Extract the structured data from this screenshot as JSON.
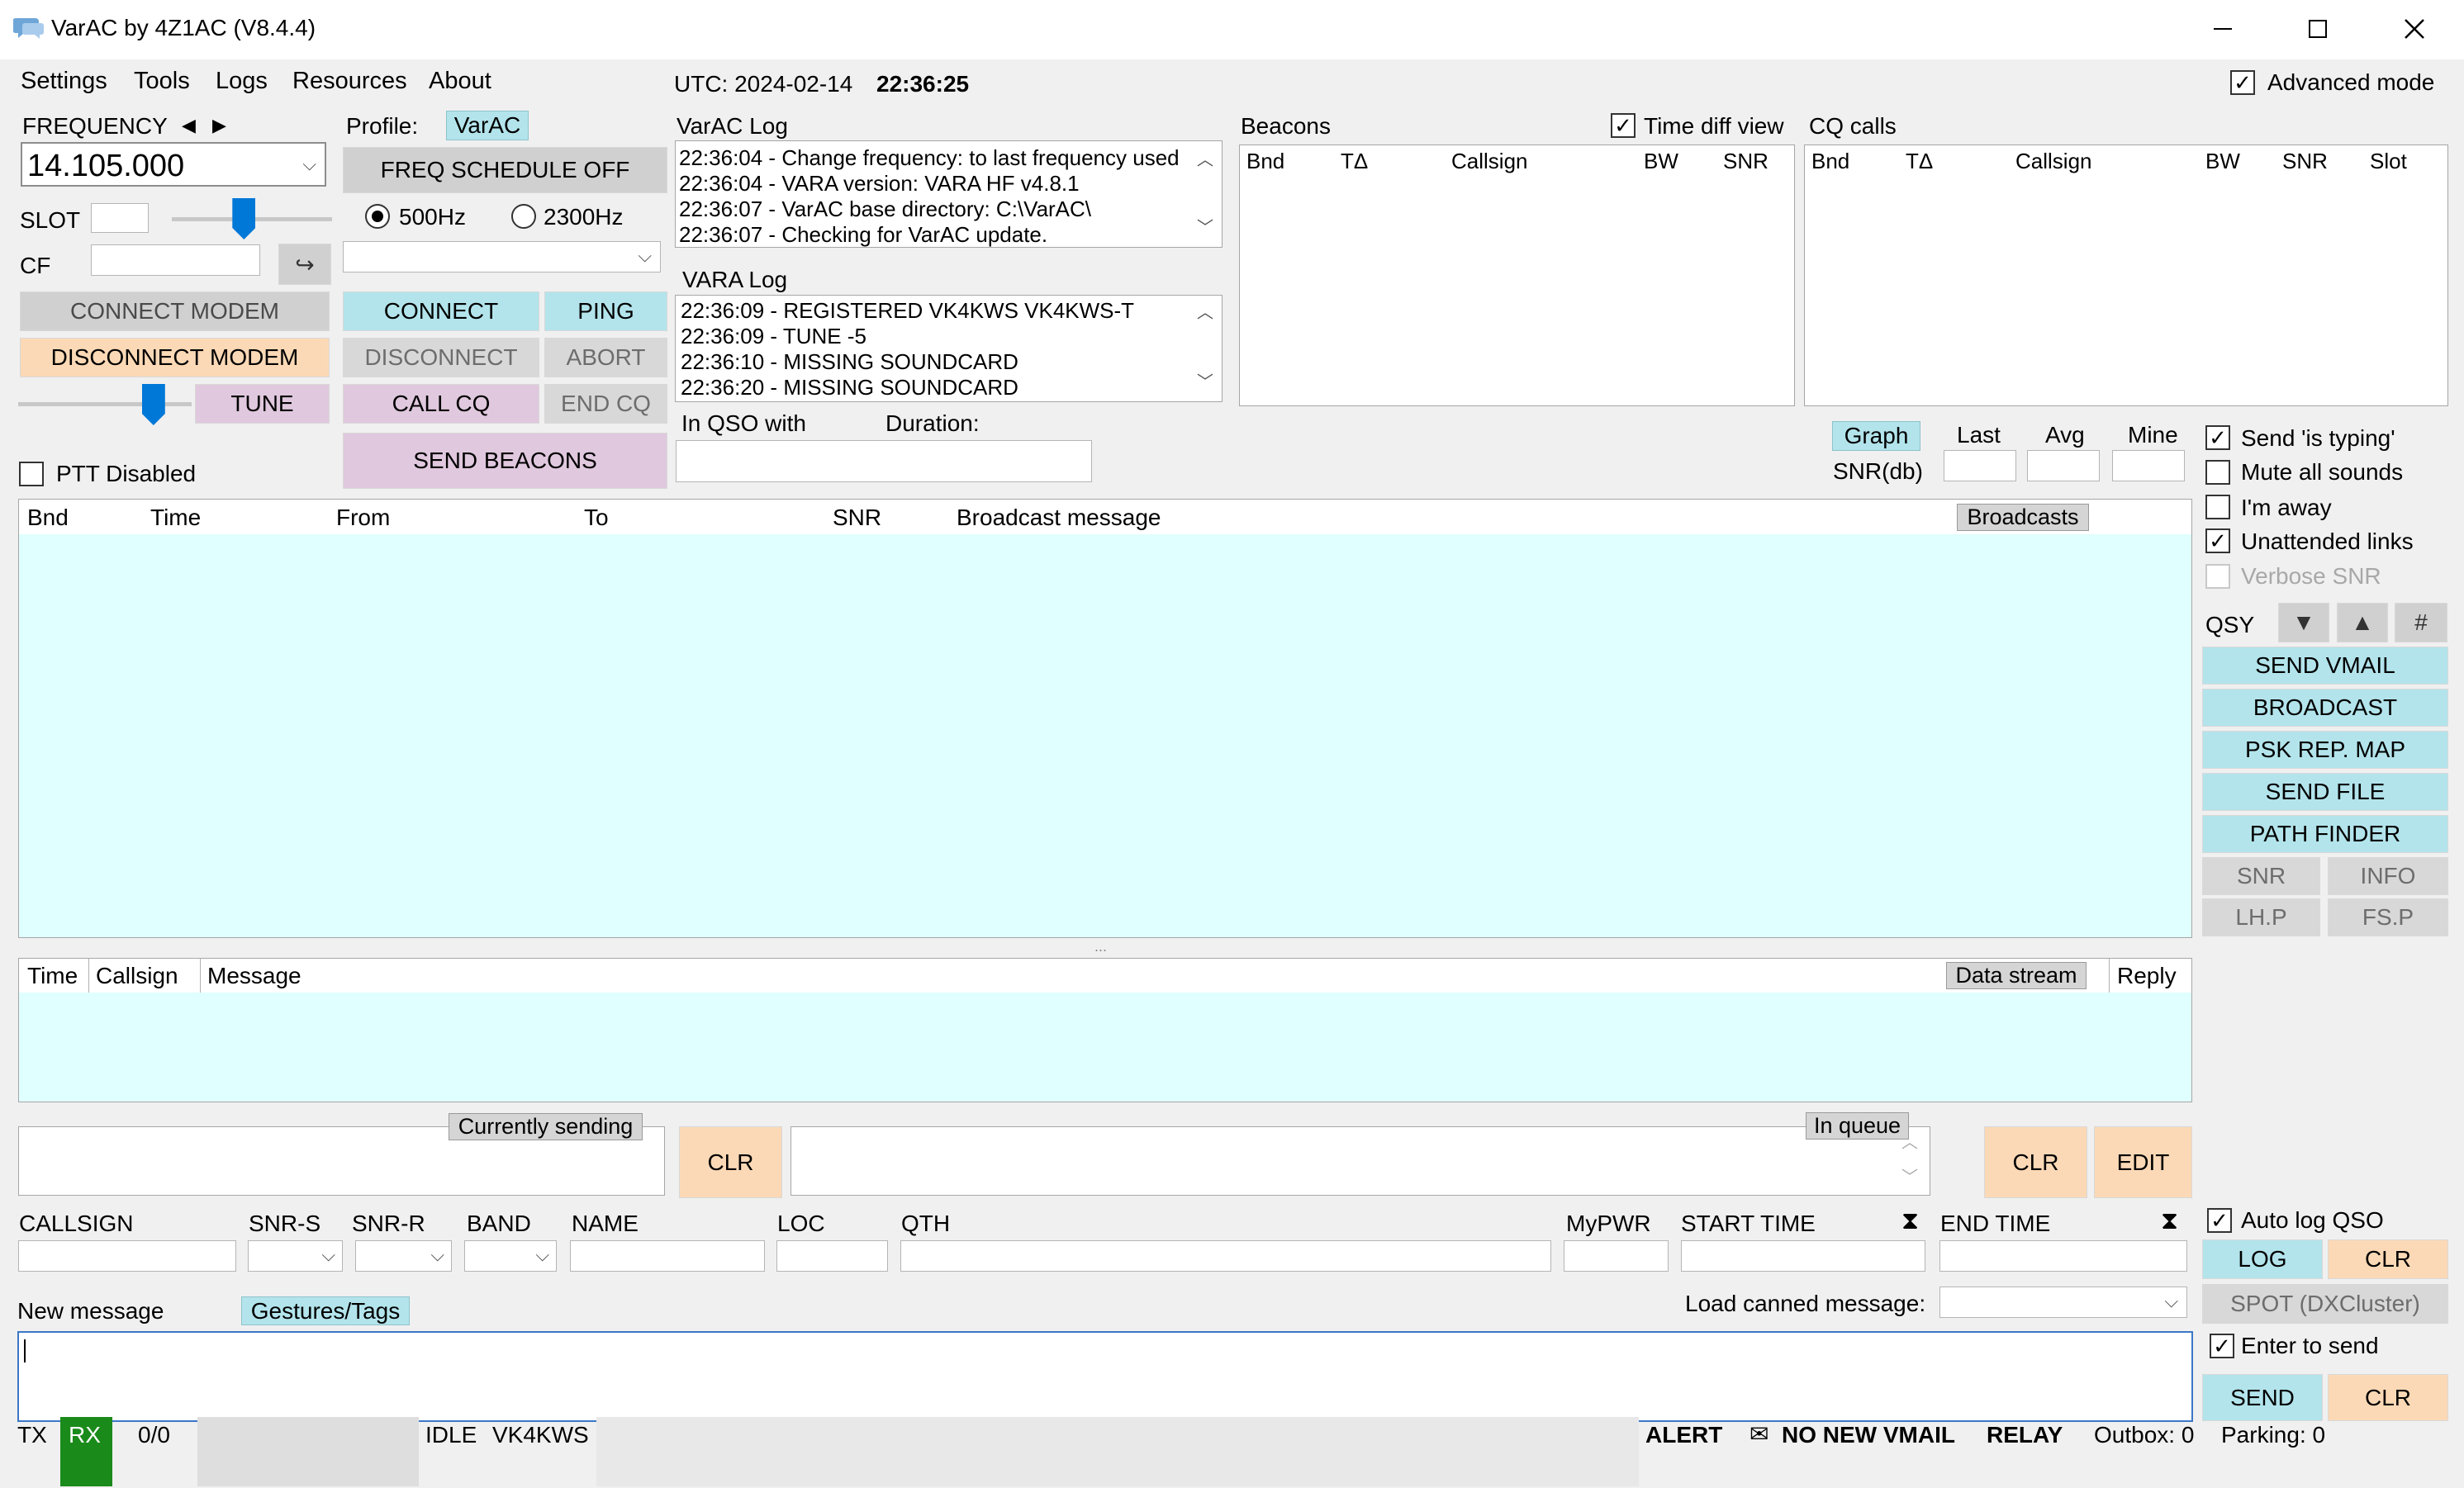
{
  "window": {
    "title": "VarAC by 4Z1AC (V8.4.4)"
  },
  "menu": [
    "Settings",
    "Tools",
    "Logs",
    "Resources",
    "About"
  ],
  "utc": {
    "label": "UTC: 2024-02-14",
    "time": "22:36:25"
  },
  "advanced_mode": {
    "label": "Advanced mode",
    "checked": true
  },
  "frequency": {
    "label": "FREQUENCY",
    "left_arrow": "◀",
    "right_arrow": "▶",
    "value": "14.105.000"
  },
  "slot": {
    "label": "SLOT",
    "value": "",
    "slider_fraction": 0.45
  },
  "cf": {
    "label": "CF",
    "value": "",
    "button_icon": "↪"
  },
  "modem": {
    "connect": "CONNECT MODEM",
    "disconnect": "DISCONNECT MODEM",
    "tune": "TUNE",
    "tune_slider_fraction": 0.78
  },
  "ptt": {
    "label": "PTT Disabled",
    "checked": false
  },
  "profile": {
    "label": "Profile:",
    "value": "VarAC",
    "freq_schedule": "FREQ SCHEDULE OFF",
    "bw_500": "500Hz",
    "bw_2300": "2300Hz",
    "bw_selected": "500Hz",
    "dropdown_value": ""
  },
  "actions": {
    "connect": "CONNECT",
    "ping": "PING",
    "disconnect": "DISCONNECT",
    "abort": "ABORT",
    "call_cq": "CALL CQ",
    "end_cq": "END CQ",
    "send_beacons": "SEND BEACONS"
  },
  "varac_log": {
    "title": "VarAC Log",
    "lines": [
      "22:36:04 - Change frequency: to last frequency used",
      "22:36:04 - VARA version: VARA HF v4.8.1",
      "22:36:07 - VarAC base directory: C:\\VarAC\\",
      "22:36:07 - Checking for VarAC update."
    ]
  },
  "vara_log": {
    "title": "VARA Log",
    "lines": [
      "22:36:09 - REGISTERED VK4KWS VK4KWS-T",
      "22:36:09 - TUNE -5",
      "22:36:10 - MISSING SOUNDCARD",
      "22:36:20 - MISSING SOUNDCARD"
    ]
  },
  "qso": {
    "in_qso_with": "In QSO with",
    "duration": "Duration:",
    "value": ""
  },
  "beacons": {
    "title": "Beacons",
    "time_diff_view": "Time diff view",
    "time_diff_checked": true,
    "columns": [
      "Bnd",
      "TΔ",
      "Callsign",
      "BW",
      "SNR"
    ]
  },
  "cq_calls": {
    "title": "CQ calls",
    "columns": [
      "Bnd",
      "TΔ",
      "Callsign",
      "BW",
      "SNR",
      "Slot"
    ]
  },
  "snr": {
    "graph": "Graph",
    "label": "SNR(db)",
    "last": "Last",
    "avg": "Avg",
    "mine": "Mine"
  },
  "options": [
    {
      "label": "Send 'is typing'",
      "checked": true,
      "disabled": false
    },
    {
      "label": "Mute all sounds",
      "checked": false,
      "disabled": false
    },
    {
      "label": "I'm away",
      "checked": false,
      "disabled": false
    },
    {
      "label": "Unattended links",
      "checked": true,
      "disabled": false
    },
    {
      "label": "Verbose SNR",
      "checked": false,
      "disabled": true
    }
  ],
  "qsy": {
    "label": "QSY",
    "down_icon": "▼",
    "up_icon": "▲",
    "hash": "#"
  },
  "right_buttons": {
    "send_vmail": "SEND VMAIL",
    "broadcast": "BROADCAST",
    "psk_map": "PSK REP. MAP",
    "send_file": "SEND FILE",
    "path_finder": "PATH FINDER",
    "snr": "SNR",
    "info": "INFO",
    "lhp": "LH.P",
    "fsp": "FS.P"
  },
  "broadcast_table": {
    "columns": [
      "Bnd",
      "Time",
      "From",
      "To",
      "SNR",
      "Broadcast message"
    ],
    "tag": "Broadcasts"
  },
  "splitter": "...",
  "message_table": {
    "columns": [
      "Time",
      "Callsign",
      "Message"
    ],
    "tag": "Data stream",
    "reply": "Reply"
  },
  "sending": {
    "currently_sending": "Currently sending",
    "clr": "CLR",
    "in_queue": "In queue",
    "clr2": "CLR",
    "edit": "EDIT"
  },
  "log_fields": {
    "callsign": "CALLSIGN",
    "snr_s": "SNR-S",
    "snr_r": "SNR-R",
    "band": "BAND",
    "name": "NAME",
    "loc": "LOC",
    "qth": "QTH",
    "mypwr": "MyPWR",
    "start_time": "START TIME",
    "end_time": "END TIME",
    "timer_icon": "⧗"
  },
  "auto_log": {
    "label": "Auto log QSO",
    "checked": true,
    "log": "LOG",
    "clr": "CLR",
    "spot": "SPOT (DXCluster)"
  },
  "new_message": {
    "label": "New message",
    "gestures": "Gestures/Tags",
    "canned_label": "Load canned message:",
    "value": ""
  },
  "enter_to_send": {
    "label": "Enter to send",
    "checked": true,
    "send": "SEND",
    "clr": "CLR"
  },
  "status": {
    "tx": "TX",
    "rx": "RX",
    "count": "0/0",
    "state": "IDLE",
    "callsign": "VK4KWS",
    "alert": "ALERT",
    "vmail_icon": "✉",
    "vmail": "NO NEW VMAIL",
    "relay": "RELAY",
    "outbox": "Outbox: 0",
    "parking": "Parking: 0"
  },
  "colors": {
    "cyan": "#b3e4ec",
    "peach": "#fcd9b6",
    "purple": "#e0c8de",
    "table_bg": "#e0ffff",
    "rx_green": "#1a8a1a"
  }
}
